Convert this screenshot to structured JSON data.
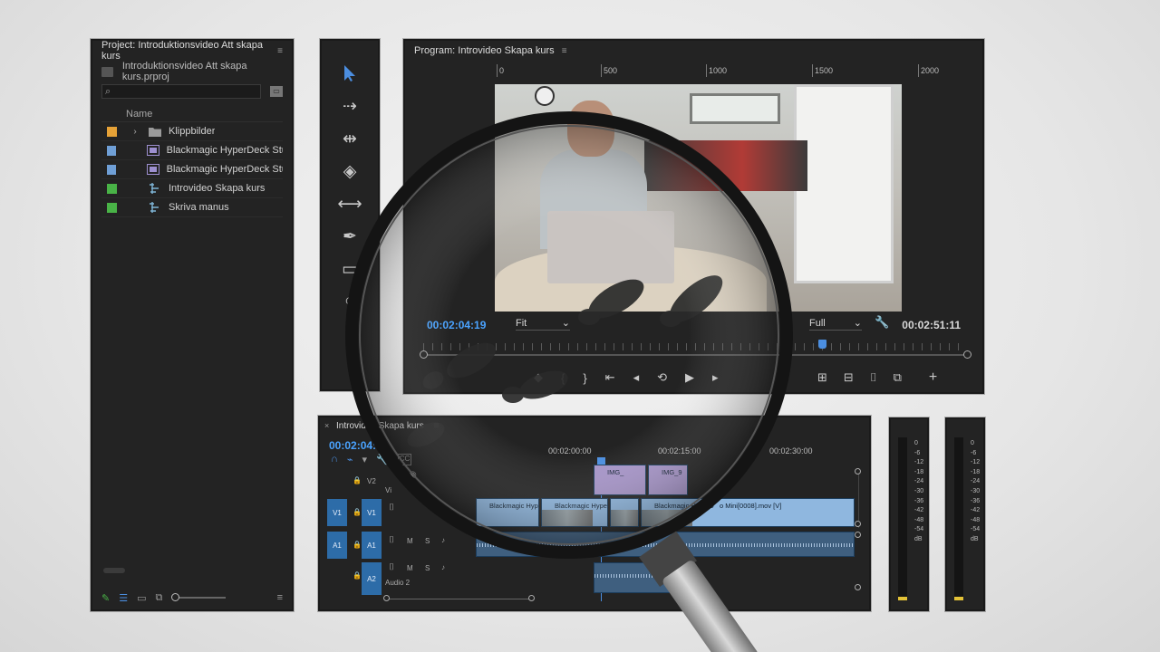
{
  "project": {
    "title": "Project: Introduktionsvideo Att skapa kurs",
    "menu": "≡",
    "file_name": "Introduktionsvideo Att skapa kurs.prproj",
    "search_placeholder": "",
    "column_name": "Name",
    "items": [
      {
        "label": "Klippbilder",
        "color": "#e6a237",
        "icon": "folder-icon",
        "expander": "›"
      },
      {
        "label": "Blackmagic HyperDeck Studi",
        "color": "#6f9fd6",
        "icon": "clip-icon"
      },
      {
        "label": "Blackmagic HyperDeck Studi",
        "color": "#6f9fd6",
        "icon": "clip-icon"
      },
      {
        "label": "Introvideo Skapa kurs",
        "color": "#49b347",
        "icon": "sequence-icon"
      },
      {
        "label": "Skriva manus",
        "color": "#49b347",
        "icon": "sequence-icon"
      }
    ]
  },
  "program": {
    "title": "Program: Introvideo Skapa kurs",
    "menu": "≡",
    "ruler_labels": [
      "0",
      "500",
      "1000",
      "1500",
      "2000"
    ],
    "timecode_current": "00:02:04:19",
    "fit_select": "Fit",
    "quality_select": "Full",
    "timecode_duration": "00:02:51:11",
    "playhead_fraction": 0.73
  },
  "timeline": {
    "tab_label": "Introvideo Skapa kurs",
    "menu": "≡",
    "close": "×",
    "timecode": "00:02:04:19",
    "time_labels": [
      "00:02:00:00",
      "00:02:15:00",
      "00:02:30:00"
    ],
    "tracks": {
      "v2": "V2",
      "v1": "V1",
      "a1": "A1",
      "a2": "A2",
      "audio2_name": "Audio 2",
      "video_short": "Vi"
    },
    "clips": {
      "img1": "IMG_",
      "img2": "IMG_9",
      "bm1": "Blackmagic Hyp",
      "bm2": "Blackmagic Hype",
      "bm3": "Blackmagic HyperD",
      "bm4": "o Mini[0008].mov [V]"
    }
  },
  "meters": {
    "scale": [
      "0",
      "-6",
      "-12",
      "-18",
      "-24",
      "-30",
      "-36",
      "-42",
      "-48",
      "-54",
      "dB"
    ]
  },
  "colors": {
    "accent": "#4b8ee0",
    "timecode": "#4aa3ff",
    "target": "#2d6ca8",
    "video_clip": "#8fb7df",
    "audio_clip": "#3f5f7f"
  }
}
